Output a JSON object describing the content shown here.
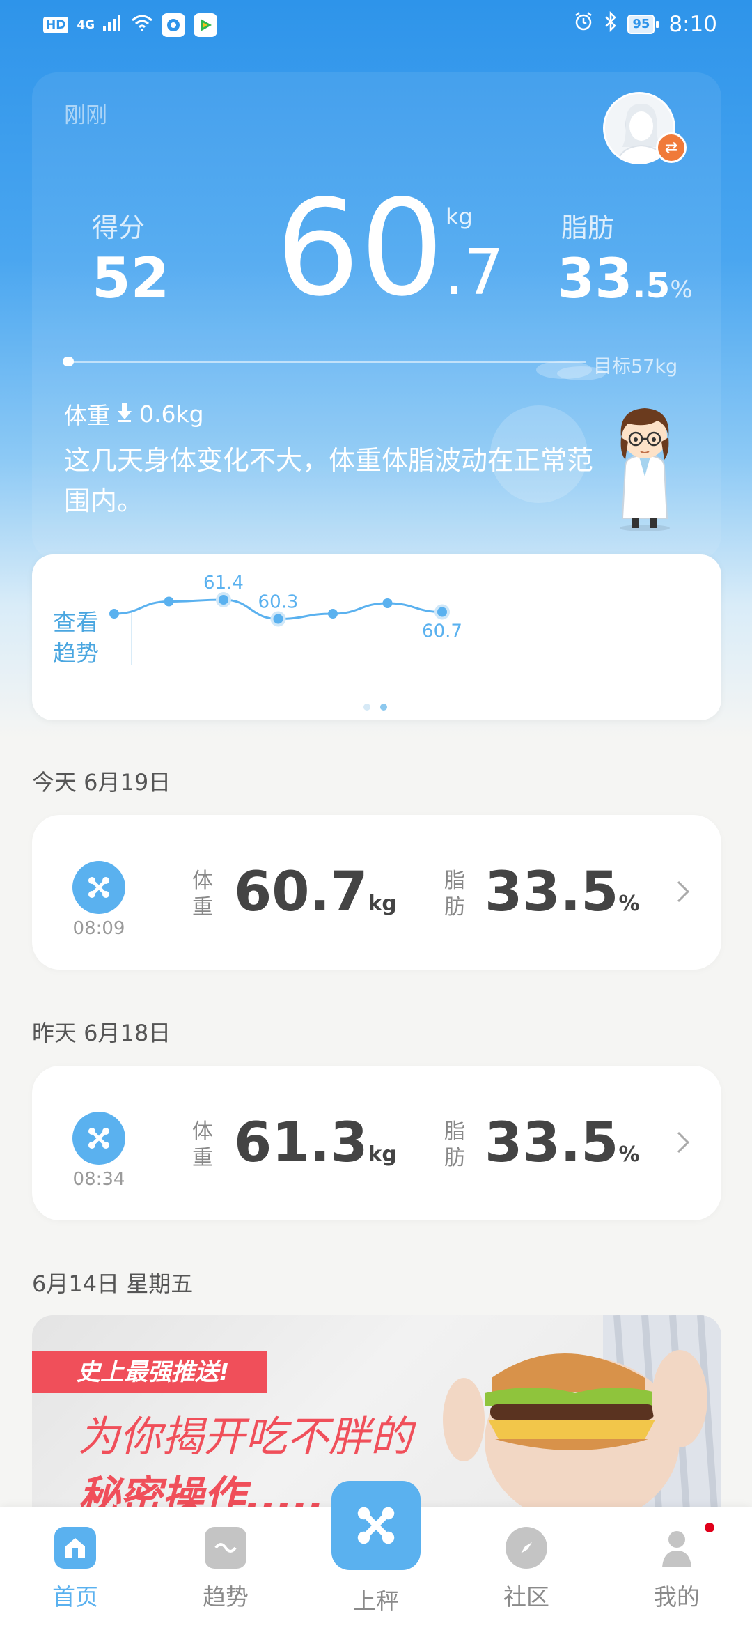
{
  "status_bar": {
    "hd": "HD",
    "net": "4G",
    "battery": "95",
    "time": "8:10"
  },
  "hero": {
    "timestamp": "刚刚",
    "score_label": "得分",
    "score_value": "52",
    "weight_int": "60",
    "weight_dec": ".7",
    "weight_unit": "kg",
    "fat_label": "脂肪",
    "fat_int": "33",
    "fat_dec": ".5",
    "fat_unit": "%",
    "goal_text": "目标57kg",
    "delta_label": "体重",
    "delta_value": "0.6kg",
    "advice": "这几天身体变化不大，体重体脂波动在正常范围内。"
  },
  "trend": {
    "label": "查看趋势",
    "point_labels": [
      "61.4",
      "60.3",
      "60.7"
    ],
    "chart_data": {
      "type": "line",
      "values": [
        60.6,
        61.3,
        61.4,
        60.3,
        60.6,
        61.2,
        60.7
      ],
      "labeled_indices": [
        2,
        3,
        6
      ]
    }
  },
  "records": [
    {
      "day_header": "今天 6月19日",
      "time": "08:09",
      "weight_label": "体重",
      "weight_value": "60.7",
      "weight_unit": "kg",
      "fat_label": "脂肪",
      "fat_value": "33.5",
      "fat_unit": "%"
    },
    {
      "day_header": "昨天 6月18日",
      "time": "08:34",
      "weight_label": "体重",
      "weight_value": "61.3",
      "weight_unit": "kg",
      "fat_label": "脂肪",
      "fat_value": "33.5",
      "fat_unit": "%"
    }
  ],
  "promo": {
    "date_header": "6月14日  星期五",
    "tag": "史上最强推送!",
    "line1": "为你揭开吃不胖的",
    "line2": "秘密操作....."
  },
  "nav": {
    "home": "首页",
    "trend": "趋势",
    "weigh": "上秤",
    "community": "社区",
    "me": "我的"
  },
  "colors": {
    "accent": "#5ab1ef",
    "hero_top": "#2e94ea",
    "promo_red": "#f04f5a",
    "badge_red": "#e0001a"
  }
}
